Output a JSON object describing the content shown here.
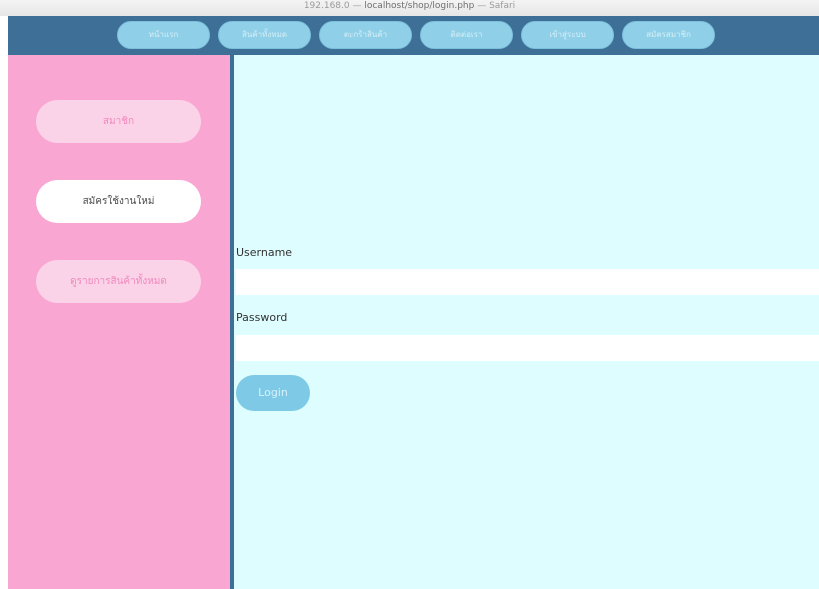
{
  "window": {
    "title_prefix": "192.168.0 — ",
    "title_main": "localhost/shop/login.php",
    "title_suffix": " — Safari"
  },
  "topnav": {
    "items": [
      {
        "label": "หน้าแรก"
      },
      {
        "label": "สินค้าทั้งหมด"
      },
      {
        "label": "ตะกร้าสินค้า"
      },
      {
        "label": "ติดต่อเรา"
      },
      {
        "label": "เข้าสู่ระบบ"
      },
      {
        "label": "สมัครสมาชิก"
      }
    ]
  },
  "sidebar": {
    "items": [
      {
        "label": "สมาชิก"
      },
      {
        "label": "สมัครใช้งานใหม่"
      },
      {
        "label": "ดูรายการสินค้าทั้งหมด"
      }
    ]
  },
  "login_form": {
    "username_label": "Username",
    "username_value": "",
    "password_label": "Password",
    "password_value": "",
    "login_button": "Login"
  },
  "colors": {
    "nav_bar": "#3e6f96",
    "nav_button": "#8fd0e8",
    "sidebar": "#f9a6d2",
    "sidebar_button": "#fbd3e8",
    "main_bg": "#ddfdff",
    "login_button": "#7ec9e6"
  }
}
